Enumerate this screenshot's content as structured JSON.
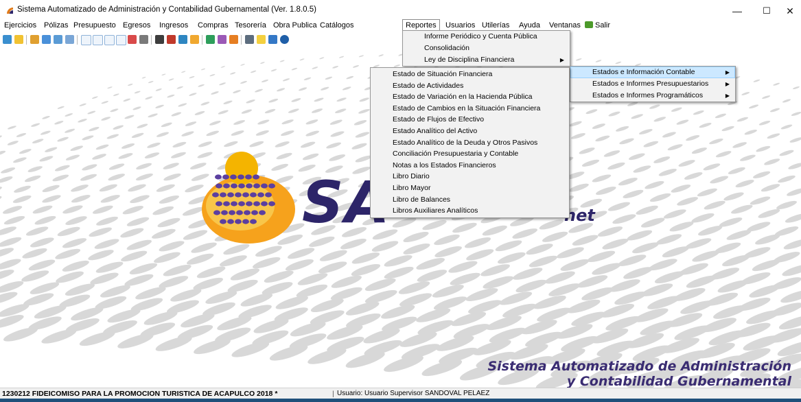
{
  "window": {
    "title": "Sistema Automatizado de Administración y Contabilidad Gubernamental  (Ver. 1.8.0.5)",
    "minimize_glyph": "—",
    "maximize_glyph": "☐",
    "close_glyph": "✕"
  },
  "menubar": {
    "items": [
      {
        "label": "Ejercicios"
      },
      {
        "label": "Pólizas"
      },
      {
        "label": "Presupuesto"
      },
      {
        "label": "Egresos"
      },
      {
        "label": "Ingresos"
      },
      {
        "label": "Compras"
      },
      {
        "label": "Tesorería"
      },
      {
        "label": "Obra Publica"
      },
      {
        "label": "Catálogos"
      },
      {
        "label": "Reportes",
        "active": true
      },
      {
        "label": "Usuarios"
      },
      {
        "label": "Utilerías"
      },
      {
        "label": "Ayuda"
      },
      {
        "label": "Ventanas"
      },
      {
        "label": "Salir",
        "icon": "exit-icon"
      }
    ]
  },
  "toolbar": {
    "icons": [
      "refresh-icon",
      "document-icon",
      "folder-icon",
      "edit-icon",
      "calendar-icon",
      "grid-icon",
      "report-icon",
      "report-icon",
      "report-icon",
      "report-icon",
      "image-icon",
      "print-icon",
      "book-icon",
      "chart-icon",
      "users-icon",
      "box-icon",
      "table-icon",
      "tools-icon",
      "key-icon",
      "tree-icon",
      "search-icon",
      "save-icon",
      "help-icon"
    ]
  },
  "menus": {
    "reportes": {
      "items": [
        {
          "label": "Informe Periódico y Cuenta Pública"
        },
        {
          "label": "Consolidación"
        },
        {
          "label": "Ley de Disciplina Financiera",
          "submenu": true
        }
      ]
    },
    "ldf": {
      "items": [
        {
          "label": "Estados e Información Contable",
          "submenu": true,
          "highlighted": true
        },
        {
          "label": "Estados e Informes Presupuestarios",
          "submenu": true
        },
        {
          "label": "Estados e Informes Programáticos",
          "submenu": true
        }
      ]
    },
    "estados": {
      "items": [
        {
          "label": "Estado de Situación Financiera"
        },
        {
          "label": "Estado de Actividades"
        },
        {
          "label": "Estado de Variación en la Hacienda Pública"
        },
        {
          "label": "Estado de Cambios en la Situación Financiera"
        },
        {
          "label": "Estado de Flujos de Efectivo"
        },
        {
          "label": "Estado Analítico del Activo"
        },
        {
          "label": "Estado Analítico de la Deuda y Otros Pasivos"
        },
        {
          "label": "Conciliación Presupuestaria y Contable"
        },
        {
          "label": "Notas a los Estados Financieros"
        },
        {
          "label": "Libro Diario"
        },
        {
          "label": "Libro Mayor"
        },
        {
          "label": "Libro de Balances"
        },
        {
          "label": "Libros Auxiliares Analíticos"
        }
      ]
    }
  },
  "background": {
    "logo_text": "SA",
    "logo_suffix": "net",
    "footer_line1": "Sistema Automatizado de Administración",
    "footer_line2": "y Contabilidad Gubernamental",
    "brand_purple": "#2d2569",
    "dot_color": "#d8d8d8",
    "orange": "#f6a21c"
  },
  "statusbar": {
    "company": "1230212 FIDEICOMISO PARA LA PROMOCION TURISTICA DE ACAPULCO  2018  *",
    "separator": "|",
    "user": "Usuario: Usuario Supervisor SANDOVAL PELAEZ"
  }
}
